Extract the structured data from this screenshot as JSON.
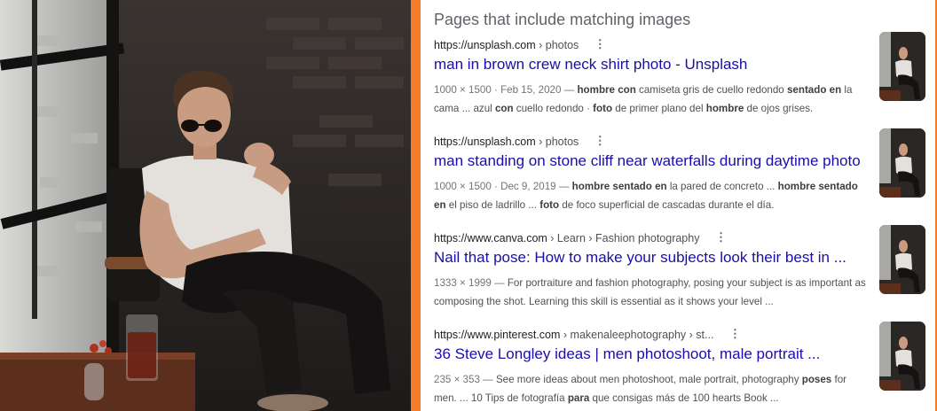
{
  "section_title": "Pages that include matching images",
  "results": [
    {
      "site": "https://unsplash.com",
      "path": " › photos",
      "title": "man in brown crew neck shirt photo - Unsplash",
      "snippet": {
        "meta": "1000 × 1500 · Feb 15, 2020 — ",
        "parts": [
          {
            "b": "hombre con"
          },
          {
            "t": " camiseta gris de cuello redondo "
          },
          {
            "b": "sentado en"
          },
          {
            "t": " la cama ... azul "
          },
          {
            "b": "con"
          },
          {
            "t": " cuello redondo · "
          },
          {
            "b": "foto"
          },
          {
            "t": " de primer plano del "
          },
          {
            "b": "hombre"
          },
          {
            "t": " de ojos grises."
          }
        ]
      }
    },
    {
      "site": "https://unsplash.com",
      "path": " › photos",
      "title": "man standing on stone cliff near waterfalls during daytime photo",
      "snippet": {
        "meta": "1000 × 1500 · Dec 9, 2019 — ",
        "parts": [
          {
            "b": "hombre sentado en"
          },
          {
            "t": " la pared de concreto ... "
          },
          {
            "b": "hombre sentado en"
          },
          {
            "t": " el piso de ladrillo ... "
          },
          {
            "b": "foto"
          },
          {
            "t": " de foco superficial de cascadas durante el día."
          }
        ]
      }
    },
    {
      "site": "https://www.canva.com",
      "path": " › Learn › Fashion photography",
      "title": "Nail that pose: How to make your subjects look their best in ...",
      "snippet": {
        "meta": "1333 × 1999 — ",
        "parts": [
          {
            "t": "For portraiture and fashion photography, posing your subject is as important as composing the shot. Learning this skill is essential as it shows your level ..."
          }
        ]
      }
    },
    {
      "site": "https://www.pinterest.com",
      "path": " › makenaleephotography › st...",
      "title": "36 Steve Longley ideas | men photoshoot, male portrait ...",
      "snippet": {
        "meta": "235 × 353 — ",
        "parts": [
          {
            "t": "See more ideas about men photoshoot, male portrait, photography "
          },
          {
            "b": "poses"
          },
          {
            "t": " for men. ... 10 Tips de fotografía "
          },
          {
            "b": "para"
          },
          {
            "t": " que consigas más de 100 hearts Book ..."
          }
        ]
      }
    }
  ],
  "icons": {
    "more": "⋮"
  },
  "colors": {
    "border": "#f57c2b",
    "link": "#1a0dab",
    "section_title": "#5f6368",
    "snippet": "#4d5156"
  }
}
